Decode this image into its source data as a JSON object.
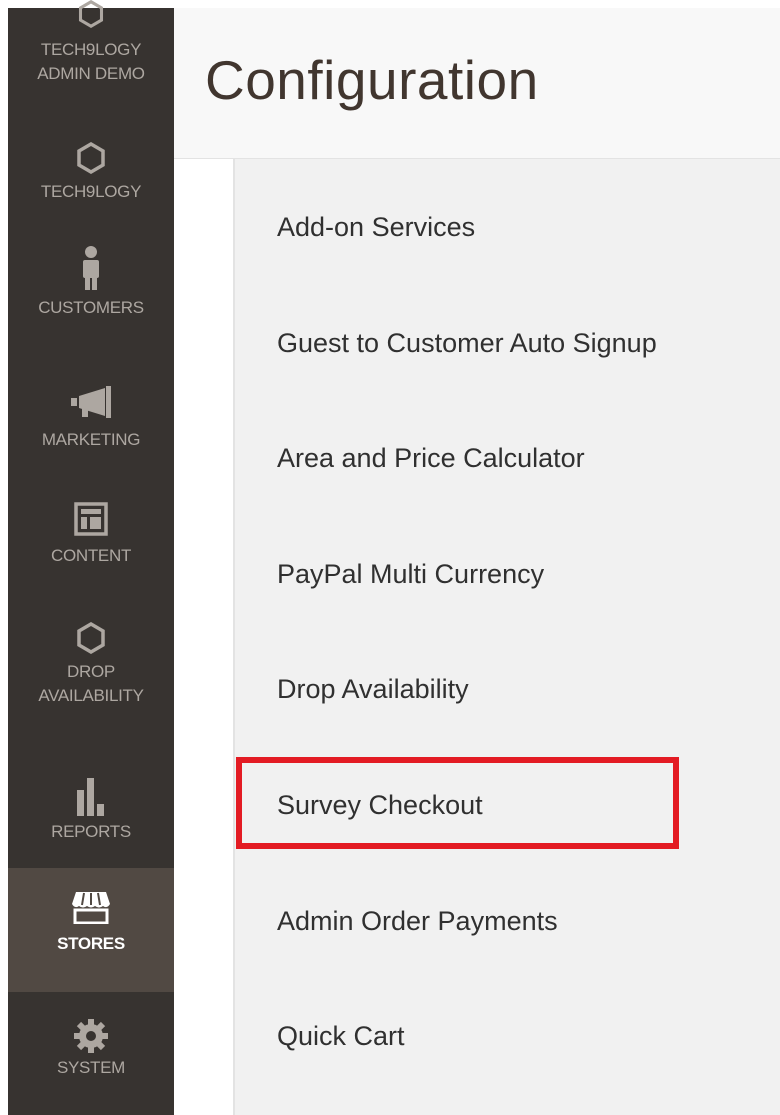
{
  "sidebar": {
    "items": [
      {
        "label_line1": "TECH9LOGY",
        "label_line2": "ADMIN DEMO",
        "icon": "hexagon-icon"
      },
      {
        "label": "TECH9LOGY",
        "icon": "hexagon-icon"
      },
      {
        "label": "CUSTOMERS",
        "icon": "person-icon"
      },
      {
        "label": "MARKETING",
        "icon": "megaphone-icon"
      },
      {
        "label": "CONTENT",
        "icon": "layout-icon"
      },
      {
        "label_line1": "DROP",
        "label_line2": "AVAILABILITY",
        "icon": "hexagon-icon"
      },
      {
        "label": "REPORTS",
        "icon": "bar-chart-icon"
      },
      {
        "label": "STORES",
        "icon": "store-icon",
        "active": true
      },
      {
        "label": "SYSTEM",
        "icon": "gear-icon"
      }
    ]
  },
  "header": {
    "title": "Configuration"
  },
  "config": {
    "items": [
      {
        "label": "Add-on Services"
      },
      {
        "label": "Guest to Customer Auto Signup"
      },
      {
        "label": "Area and Price Calculator"
      },
      {
        "label": "PayPal Multi Currency"
      },
      {
        "label": "Drop Availability"
      },
      {
        "label": "Survey Checkout",
        "highlighted": true
      },
      {
        "label": "Admin Order Payments"
      },
      {
        "label": "Quick Cart"
      }
    ]
  },
  "colors": {
    "sidebar_bg": "#373330",
    "sidebar_active_bg": "#514943",
    "highlight_border": "#e31b23"
  }
}
